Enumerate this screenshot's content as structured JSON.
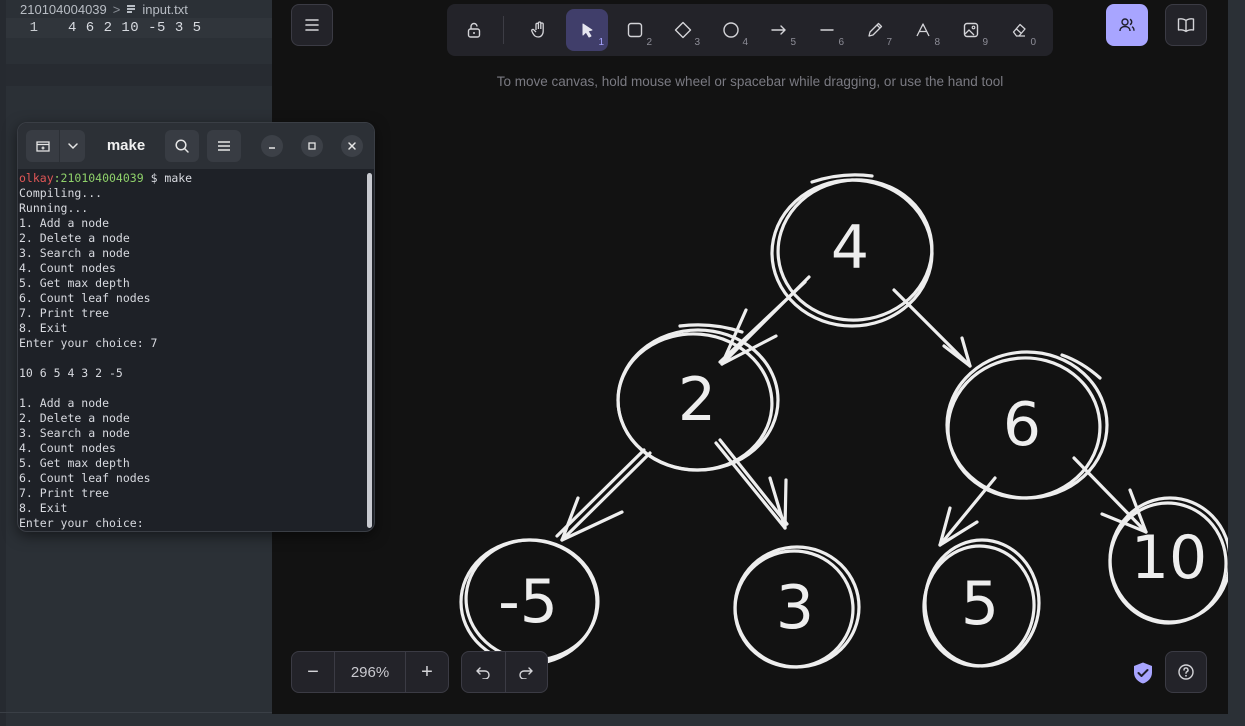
{
  "editor": {
    "breadcrumb_folder": "210104004039",
    "breadcrumb_sep": ">",
    "breadcrumb_file": "input.txt",
    "line_number": "1",
    "line_content": "4 6 2 10 -5 3 5"
  },
  "canvas": {
    "hint": "To move canvas, hold mouse wheel or spacebar while dragging, or use the hand tool",
    "zoom": "296%",
    "zoom_out_label": "−",
    "zoom_in_label": "+",
    "tools": [
      {
        "name": "lock",
        "num": ""
      },
      {
        "name": "hand",
        "num": ""
      },
      {
        "name": "selection",
        "num": "1"
      },
      {
        "name": "rectangle",
        "num": "2"
      },
      {
        "name": "diamond",
        "num": "3"
      },
      {
        "name": "ellipse",
        "num": "4"
      },
      {
        "name": "arrow",
        "num": "5"
      },
      {
        "name": "line",
        "num": "6"
      },
      {
        "name": "draw",
        "num": "7"
      },
      {
        "name": "text",
        "num": "8"
      },
      {
        "name": "image",
        "num": "9"
      },
      {
        "name": "eraser",
        "num": "0"
      }
    ],
    "nodes": [
      "4",
      "2",
      "6",
      "-5",
      "3",
      "5",
      "10"
    ],
    "accent": "#a8a5ff"
  },
  "terminal": {
    "title": "make",
    "prompt_user": "olkay",
    "prompt_path": ":210104004039",
    "prompt_cmd": " $ make",
    "lines": [
      "Compiling...",
      "Running...",
      "1. Add a node",
      "2. Delete a node",
      "3. Search a node",
      "4. Count nodes",
      "5. Get max depth",
      "6. Count leaf nodes",
      "7. Print tree",
      "8. Exit",
      "Enter your choice: 7",
      "",
      "10 6 5 4 3 2 -5",
      "",
      "1. Add a node",
      "2. Delete a node",
      "3. Search a node",
      "4. Count nodes",
      "5. Get max depth",
      "6. Count leaf nodes",
      "7. Print tree",
      "8. Exit",
      "Enter your choice:"
    ]
  }
}
